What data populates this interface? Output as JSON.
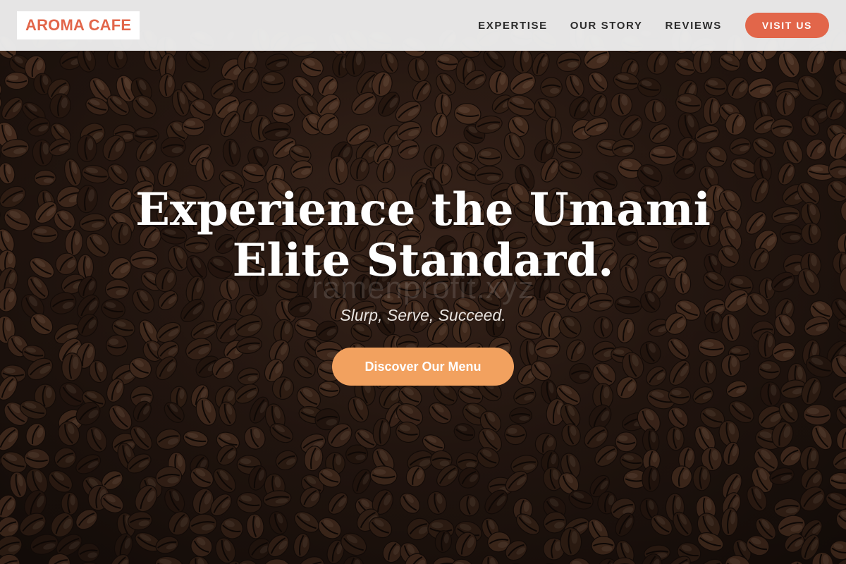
{
  "header": {
    "logo_text": "AROMA CAFE",
    "nav": [
      {
        "label": "EXPERTISE"
      },
      {
        "label": "OUR STORY"
      },
      {
        "label": "REVIEWS"
      }
    ],
    "visit_button": "VISIT US"
  },
  "hero": {
    "title_line1": "Experience the Umami",
    "title_line2": "Elite Standard.",
    "watermark": "ramenprofit.xyz",
    "subtitle": "Slurp, Serve, Succeed.",
    "cta_label": "Discover Our Menu",
    "background_icon": "coffee-beans-photo"
  },
  "colors": {
    "brand_accent": "#e2664a",
    "cta": "#f2a15f",
    "header_bg": "#eeeeee",
    "nav_text": "#2b2b2b"
  }
}
